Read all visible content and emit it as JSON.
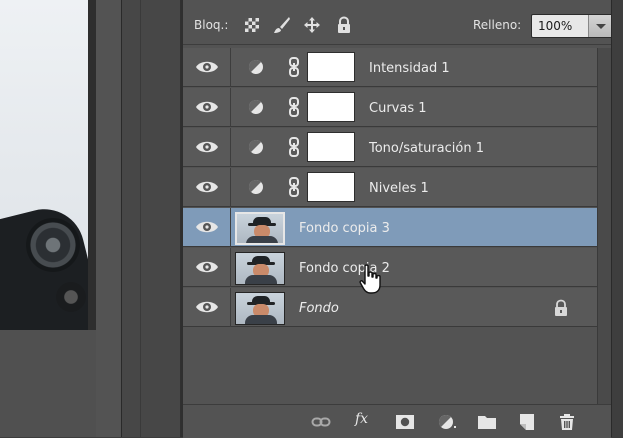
{
  "panel": {
    "lock_label": "Bloq.:",
    "fill_label": "Relleno:",
    "fill_value": "100%",
    "lock_icons": [
      "lock-transparent-icon",
      "lock-image-brush-icon",
      "lock-position-move-icon",
      "lock-all-icon"
    ]
  },
  "layers": [
    {
      "name": "Intensidad 1",
      "kind": "adjustment",
      "visible": true
    },
    {
      "name": "Curvas 1",
      "kind": "adjustment",
      "visible": true
    },
    {
      "name": "Tono/saturación 1",
      "kind": "adjustment",
      "visible": true
    },
    {
      "name": "Niveles 1",
      "kind": "adjustment",
      "visible": true
    },
    {
      "name": "Fondo copia 3",
      "kind": "pixel",
      "visible": true,
      "selected": true
    },
    {
      "name": "Fondo copia 2",
      "kind": "pixel",
      "visible": true
    },
    {
      "name": "Fondo",
      "kind": "background",
      "visible": true,
      "locked": true
    }
  ],
  "bottom_bar": {
    "fx_label": "fx",
    "icons": [
      "link-layers-icon",
      "layer-style-fx-icon",
      "add-mask-icon",
      "new-adjustment-icon",
      "new-group-folder-icon",
      "new-layer-icon",
      "delete-trash-icon"
    ]
  },
  "colors": {
    "panel_bg": "#535353",
    "row_bg": "#595959",
    "selected_row": "#7f9bb9",
    "text": "#ececec"
  }
}
